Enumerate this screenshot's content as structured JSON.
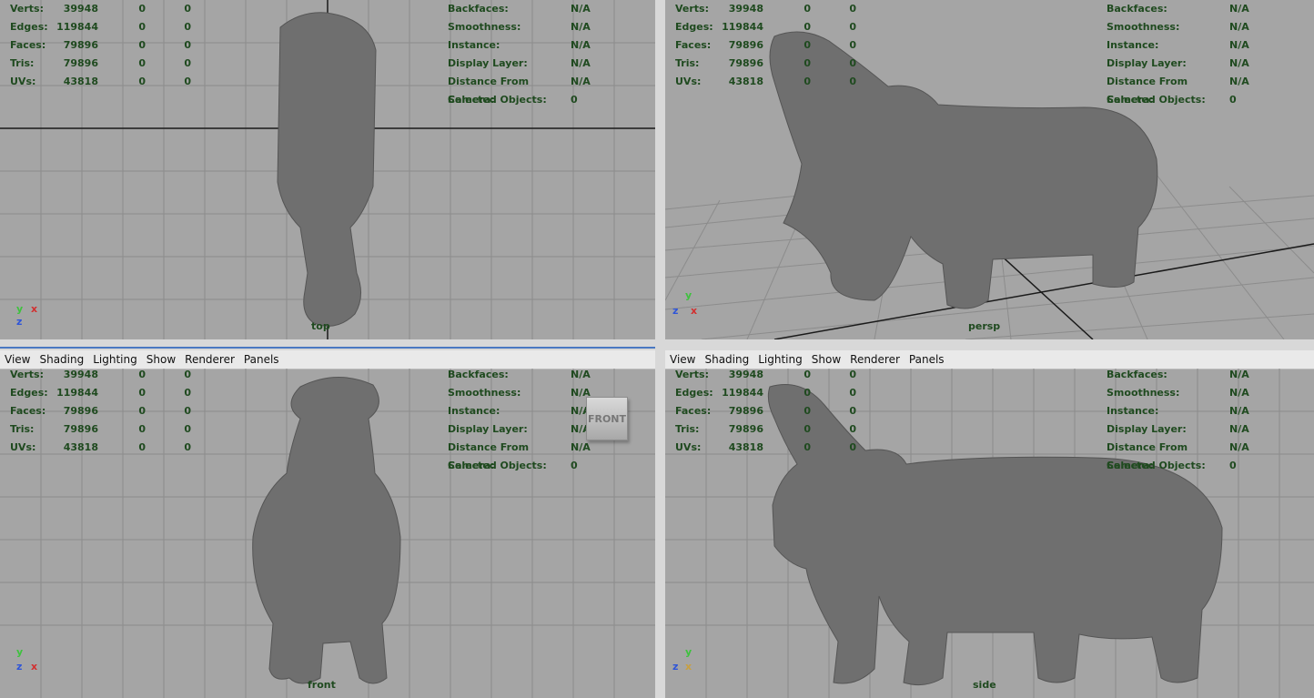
{
  "menu": [
    "View",
    "Shading",
    "Lighting",
    "Show",
    "Renderer",
    "Panels"
  ],
  "hud_left": [
    {
      "label": "Verts:",
      "v1": "39948",
      "v2": "0",
      "v3": "0"
    },
    {
      "label": "Edges:",
      "v1": "119844",
      "v2": "0",
      "v3": "0"
    },
    {
      "label": "Faces:",
      "v1": "79896",
      "v2": "0",
      "v3": "0"
    },
    {
      "label": "Tris:",
      "v1": "79896",
      "v2": "0",
      "v3": "0"
    },
    {
      "label": "UVs:",
      "v1": "43818",
      "v2": "0",
      "v3": "0"
    }
  ],
  "hud_right": [
    {
      "label": "Backfaces:",
      "value": "N/A"
    },
    {
      "label": "Smoothness:",
      "value": "N/A"
    },
    {
      "label": "Instance:",
      "value": "N/A"
    },
    {
      "label": "Display Layer:",
      "value": "N/A"
    },
    {
      "label": "Distance From Camera:",
      "value": "N/A"
    },
    {
      "label": "Selected Objects:",
      "value": "0"
    }
  ],
  "viewports": {
    "top": {
      "camera": "top",
      "axis_a": "y",
      "axis_b": "x",
      "axis_c": "z"
    },
    "persp": {
      "camera": "persp",
      "axis_a": "y",
      "axis_b": "z",
      "axis_c": "x"
    },
    "front": {
      "camera": "front",
      "axis_a": "y",
      "axis_b": "z",
      "axis_c": "x"
    },
    "side": {
      "camera": "side",
      "axis_a": "y",
      "axis_b": "z",
      "axis_c": "x"
    }
  },
  "view_cube_label": "FRONT",
  "colors": {
    "viewport_bg": "#a5a5a5",
    "grid": "#8a8a8a",
    "hud_text": "#1f4a1f",
    "model": "#707070"
  }
}
